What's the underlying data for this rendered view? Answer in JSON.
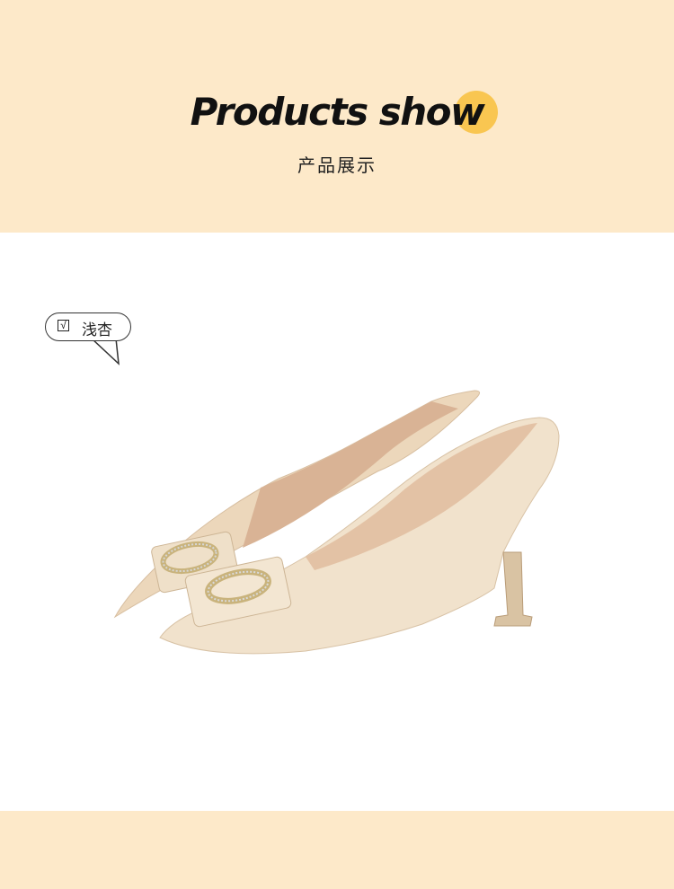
{
  "header": {
    "title": "Products show",
    "subtitle": "产品展示",
    "accent_color": "#f9c651",
    "band_color": "#fde9c9"
  },
  "color_tag": {
    "check_glyph": "√",
    "label": "浅杏"
  },
  "product": {
    "image_icon": "beige-pointed-heels-icon"
  }
}
